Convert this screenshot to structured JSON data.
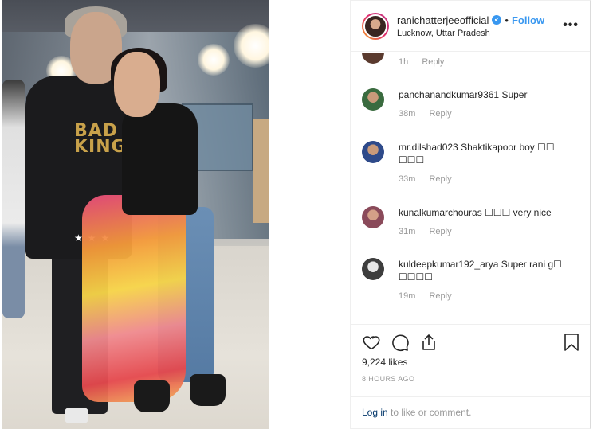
{
  "post": {
    "username": "ranichatterjeeofficial",
    "verified_badge": "✔",
    "separator": "•",
    "follow_label": "Follow",
    "location": "Lucknow, Uttar Pradesh",
    "more_label": "•••"
  },
  "photo": {
    "shirt_text_line1": "BAD",
    "shirt_text_line2": "KING",
    "stars": "★★★"
  },
  "comments": [
    {
      "user": "",
      "text": "",
      "time": "1h",
      "reply": "Reply",
      "avatar_color": "#5a3a2e"
    },
    {
      "user": "panchanandkumar9361",
      "text": "Super",
      "time": "38m",
      "reply": "Reply",
      "avatar_color": "#3a6b3f"
    },
    {
      "user": "mr.dilshad023",
      "text": "Shaktikapoor boy ☐☐ ☐☐☐",
      "time": "33m",
      "reply": "Reply",
      "avatar_color": "#2e4a8a"
    },
    {
      "user": "kunalkumarchouras",
      "text": "☐☐☐ very nice",
      "time": "31m",
      "reply": "Reply",
      "avatar_color": "#8a4a5a"
    },
    {
      "user": "kuldeepkumar192_arya",
      "text": "Super rani g☐ ☐☐☐☐",
      "time": "19m",
      "reply": "Reply",
      "avatar_color": "#3d3d3d"
    }
  ],
  "actions": {
    "likes": "9,224 likes",
    "time_ago": "8 HOURS AGO",
    "login_link": "Log in",
    "login_rest": " to like or comment."
  },
  "colors": {
    "accent": "#3897f0",
    "link": "#003569",
    "muted": "#999999",
    "text": "#262626"
  }
}
